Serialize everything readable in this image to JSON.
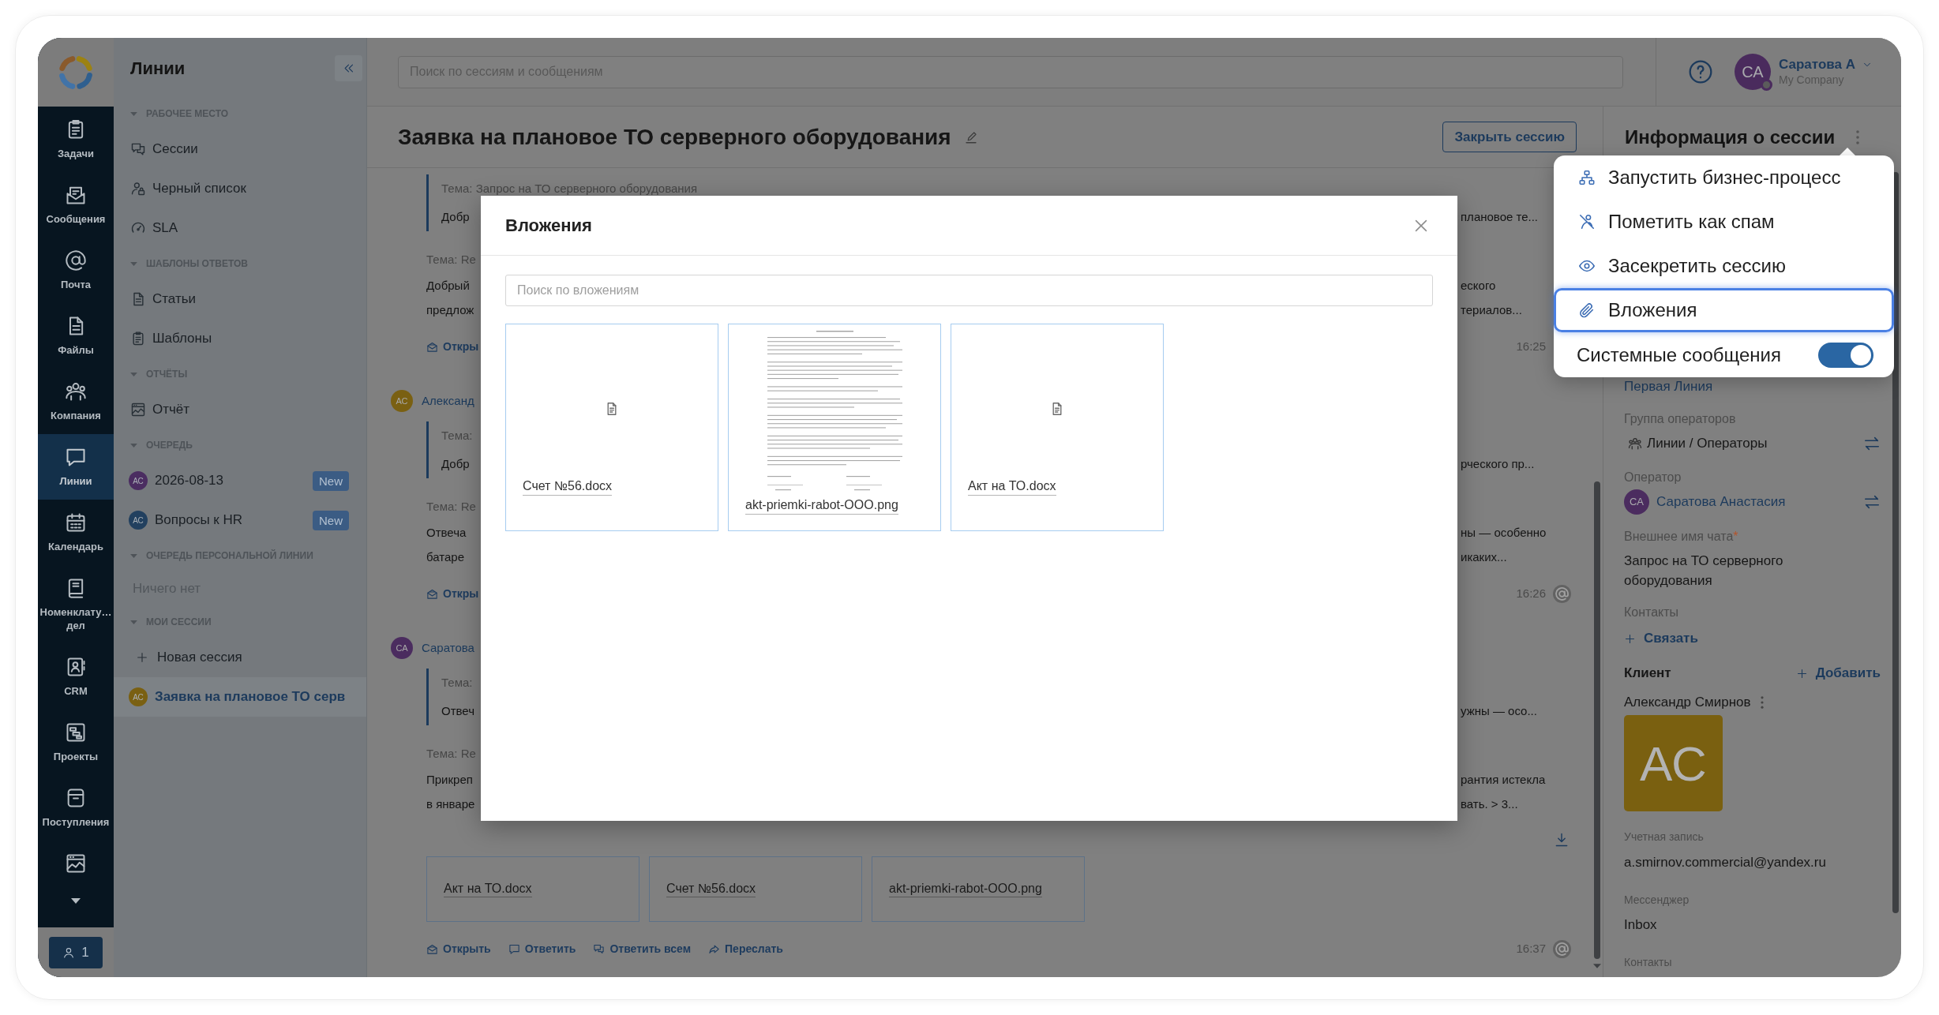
{
  "nav_rail": {
    "items": [
      {
        "label": "Задачи",
        "selected": false
      },
      {
        "label": "Сообщения",
        "selected": false
      },
      {
        "label": "Почта",
        "selected": false
      },
      {
        "label": "Файлы",
        "selected": false
      },
      {
        "label": "Компания",
        "selected": false
      },
      {
        "label": "Линии",
        "selected": true
      },
      {
        "label": "Календарь",
        "selected": false
      },
      {
        "label": "Номенклату… дел",
        "selected": false
      },
      {
        "label": "CRM",
        "selected": false
      },
      {
        "label": "Проекты",
        "selected": false
      },
      {
        "label": "Поступления",
        "selected": false
      },
      {
        "selected": false
      }
    ],
    "operators_button": {
      "count": "1"
    }
  },
  "sidebar": {
    "title": "Линии",
    "sections": [
      {
        "title": "РАБОЧЕЕ МЕСТО",
        "expanded": true,
        "items": [
          {
            "kind": "link",
            "label": "Сессии",
            "selected": false
          },
          {
            "kind": "link",
            "label": "Черный список",
            "selected": false
          },
          {
            "kind": "link",
            "label": "SLA",
            "selected": false
          }
        ]
      },
      {
        "title": "ШАБЛОНЫ ОТВЕТОВ",
        "expanded": true,
        "items": [
          {
            "kind": "link",
            "label": "Статьи",
            "selected": false
          },
          {
            "kind": "link",
            "label": "Шаблоны",
            "selected": false
          }
        ]
      },
      {
        "title": "ОТЧЁТЫ",
        "expanded": true,
        "items": [
          {
            "kind": "link",
            "label": "Отчёт",
            "selected": false
          }
        ]
      },
      {
        "title": "ОЧЕРЕДЬ",
        "expanded": true,
        "items": [
          {
            "kind": "queue",
            "initials": "АС",
            "color": "#4b2d61",
            "label": "2026-08-13",
            "badge": "New",
            "selected": false
          },
          {
            "kind": "queue",
            "initials": "АС",
            "color": "#22405f",
            "label": "Вопросы к HR",
            "badge": "New",
            "selected": false
          }
        ]
      },
      {
        "title": "ОЧЕРЕДЬ ПЕРСОНАЛЬНОЙ ЛИНИИ",
        "expanded": true,
        "items": [
          {
            "kind": "empty",
            "label": "Ничего нет"
          }
        ]
      },
      {
        "title": "МОИ СЕССИИ",
        "expanded": true,
        "items": [
          {
            "kind": "action",
            "label": "Новая сессия"
          },
          {
            "kind": "session",
            "initials": "АС",
            "color": "#7a6012",
            "label": "Заявка на плановое ТО серв",
            "selected": true
          }
        ]
      }
    ]
  },
  "top_bar": {
    "search": {
      "placeholder": "Поиск по сессиям и сообщениям"
    },
    "user": {
      "initials": "СА",
      "name": "Саратова А",
      "company": "My Company",
      "online": false
    }
  },
  "session": {
    "title": "Заявка на плановое ТО серверного оборудования",
    "close_button": "Закрыть сессию"
  },
  "chat": {
    "messages": [
      {
        "quote": {
          "subject": "Тема: Запрос на ТО серверного оборудования",
          "lines": [
            {
              "left": "Добр",
              "right": "плановое те..."
            }
          ]
        },
        "subject": "Тема: Re",
        "lines": [
          {
            "left": "Добрый",
            "right": "еского"
          },
          {
            "left": "предлож",
            "right": "териалов..."
          }
        ],
        "footer": {
          "links": [
            "Откры"
          ],
          "time": "16:25"
        }
      },
      {
        "author": {
          "initials": "АС",
          "color": "#7a6012",
          "name": "Александ"
        },
        "quote": {
          "subject": "Тема:",
          "lines": [
            {
              "left": "Добр",
              "right": "рческого пр..."
            }
          ]
        },
        "subject": "Тема: Re",
        "lines": [
          {
            "left": "Отвеча",
            "right": "ны — особенно"
          },
          {
            "left": "батаре",
            "right": "икаких..."
          }
        ],
        "footer": {
          "links": [
            "Откры"
          ],
          "time": "16:26",
          "mention": true
        }
      },
      {
        "author": {
          "initials": "СА",
          "color": "#4b2c5f",
          "name": "Саратова"
        },
        "quote": {
          "subject": "Тема:",
          "lines": [
            {
              "left": "Отвеч",
              "right": "ужны — осо..."
            }
          ]
        },
        "subject": "Тема: Re",
        "lines": [
          {
            "left": "Прикреп",
            "right": "рантия истекла"
          },
          {
            "left": "в январе",
            "right": "вать. > 3..."
          }
        ],
        "download": true,
        "attachments": [
          "Акт на ТО.docx",
          "Счет №56.docx",
          "akt-priemki-rabot-OOO.png"
        ],
        "footer": {
          "links": [
            "Открыть",
            "Ответить",
            "Ответить всем",
            "Переслать"
          ],
          "time": "16:37",
          "mention": true
        }
      }
    ]
  },
  "info_panel": {
    "title": "Информация о сессии",
    "line": "Первая Линия",
    "fields": [
      {
        "kind": "group",
        "label": "Группа операторов",
        "value": "Линии / Операторы"
      },
      {
        "kind": "operator",
        "label": "Оператор",
        "initials": "СА",
        "color": "#4b2c5f",
        "value": "Саратова Анастасия"
      },
      {
        "kind": "text",
        "label": "Внешнее имя чата",
        "required_mark": "*",
        "value": "Запрос на ТО серверного оборудования"
      },
      {
        "kind": "link",
        "label": "Контакты",
        "value": "Связать"
      }
    ],
    "client": {
      "title": "Клиент",
      "add": "Добавить",
      "name": "Александр Смирнов",
      "initials": "АС",
      "fields": [
        {
          "label": "Учетная запись",
          "value": "a.smirnov.commercial@yandex.ru"
        },
        {
          "label": "Мессенджер",
          "value": "Inbox"
        },
        {
          "label": "Контакты"
        }
      ]
    }
  },
  "session_menu": {
    "items": [
      {
        "kind": "action",
        "label": "Запустить бизнес-процесс",
        "selected": false
      },
      {
        "kind": "action",
        "label": "Пометить как спам",
        "selected": false
      },
      {
        "kind": "action",
        "label": "Засекретить сессию",
        "selected": false
      },
      {
        "kind": "action",
        "label": "Вложения",
        "selected": true
      },
      {
        "kind": "toggle",
        "label": "Системные сообщения",
        "on": true
      }
    ]
  },
  "attachments_dialog": {
    "title": "Вложения",
    "search": {
      "placeholder": "Поиск по вложениям"
    },
    "files": [
      {
        "kind": "document",
        "name": "Счет №56.docx"
      },
      {
        "kind": "image",
        "name": "akt-priemki-rabot-OOO.png"
      },
      {
        "kind": "document",
        "name": "Акт на ТО.docx"
      }
    ]
  }
}
